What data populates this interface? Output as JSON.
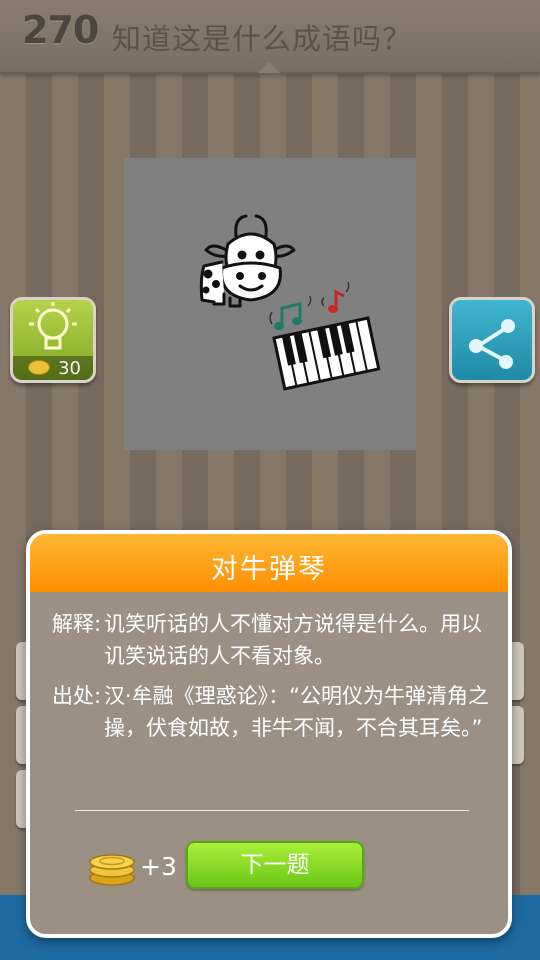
{
  "header": {
    "level": "270",
    "question": "知道这是什么成语吗？"
  },
  "hint_button": {
    "icon": "lightbulb-icon",
    "cost": "30"
  },
  "share_button": {
    "icon": "share-icon"
  },
  "puzzle": {
    "icons": [
      "cow-icon",
      "music-notes-icon",
      "piano-keyboard-icon"
    ]
  },
  "dialog": {
    "title": "对牛弹琴",
    "meaning_label": "解释:",
    "meaning_text": "讥笑听话的人不懂对方说得是什么。用以讥笑说话的人不看对象。",
    "source_label": "出处:",
    "source_text": "汉·牟融《理惑论》：“公明仪为牛弹清角之操，伏食如故，非牛不闻，不合其耳矣。”",
    "reward": "+3",
    "next_label": "下一题"
  },
  "colors": {
    "dialog_header": "#ff9800",
    "next_button": "#8fdc2a",
    "hint_button": "#9cc23a",
    "share_button": "#2ea3c0"
  }
}
